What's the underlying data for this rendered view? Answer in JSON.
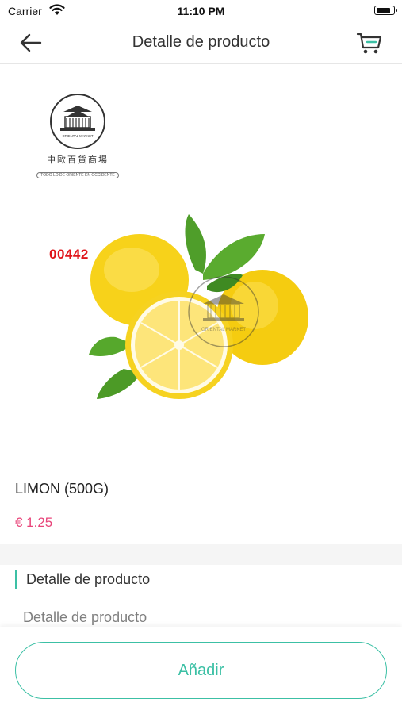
{
  "status_bar": {
    "carrier": "Carrier",
    "time": "11:10 PM",
    "battery_level": 0.9,
    "icons": [
      "wifi-icon",
      "battery-icon"
    ]
  },
  "nav": {
    "title": "Detalle de producto",
    "back_icon": "arrow-left-icon",
    "cart_icon": "cart-icon"
  },
  "store_logo": {
    "emblem_text": "ORIENTAL MARKET",
    "chinese_name": "中歐百貨商場",
    "tagline": "TODO LO DE ORIENTE EN OCCIDENTE",
    "watermark_text": "ORIENTAL MARKET"
  },
  "product": {
    "sku": "00442",
    "name": "LIMON (500G)",
    "price": "€ 1.25"
  },
  "detail_section": {
    "heading": "Detalle de producto",
    "body": "Detalle de producto"
  },
  "actions": {
    "add_label": "Añadir"
  },
  "colors": {
    "accent": "#3cc0a5",
    "price": "#e8457a",
    "sku": "#e0161c",
    "lemon": "#f7d21a"
  }
}
